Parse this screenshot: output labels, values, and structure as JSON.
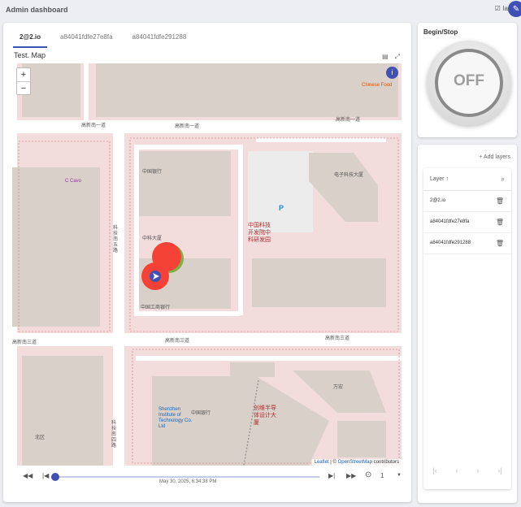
{
  "header": {
    "title": "Admin dashboard",
    "layers_label": "lay",
    "edit_icon": "pencil-icon"
  },
  "map_widget": {
    "tabs": [
      {
        "label": "2@2.io",
        "active": true
      },
      {
        "label": "a84041fdfe27e8fa",
        "active": false
      },
      {
        "label": "a84041fdfe291288",
        "active": false
      }
    ],
    "title": "Test. Map",
    "zoom_in": "+",
    "zoom_out": "−",
    "attribution": {
      "leaflet": "Leaflet",
      "separator": " | © ",
      "osm": "OpenStreetMap",
      "suffix": " contributors"
    },
    "labels": {
      "street_top_1": "高新南一道",
      "street_top_2": "高新南一道",
      "street_left": "高新南一道",
      "street_mid_1": "高新南三道",
      "street_mid_2": "高新南三道",
      "street_mid_3": "高新南三道",
      "street_vertical": "科技南五路",
      "street_vertical_2": "科技南四路",
      "poi_center": "中国科技\n开发院中\n科研发园",
      "poi_bottom": "创维半导\n体设计大\n厦",
      "poi_cafe": "C Cavo",
      "poi_coffee_1": "Chinese Food",
      "poi_p": "P",
      "poi_small_1": "中国银行",
      "poi_small_2": "中科大厦",
      "poi_small_3": "中国工商银行",
      "poi_small_4": "电子科技大厦",
      "poi_small_5": "万宏",
      "poi_small_6": "Shenzhen Institute of Technology Co. Ltd",
      "poi_small_7": "中国银行",
      "poi_small_8": "北区"
    }
  },
  "playback": {
    "timestamp": "May 30, 2025, 6:34:38 PM",
    "speed": "1",
    "progress": 0.0
  },
  "switch_widget": {
    "title": "Begin/Stop",
    "state": "OFF"
  },
  "layers_widget": {
    "add_label": "+ Add layers",
    "header": "Layer ↑",
    "rows": [
      "2@2.io",
      "a84041fdfe27e8fa",
      "a84041fdfe291288"
    ],
    "pager": [
      "|‹",
      "‹",
      "›",
      "›|"
    ]
  },
  "colors": {
    "accent": "#3f51b5",
    "marker": "#f44336",
    "map_bg": "#f2dcdc",
    "building": "#d9d0c9"
  }
}
